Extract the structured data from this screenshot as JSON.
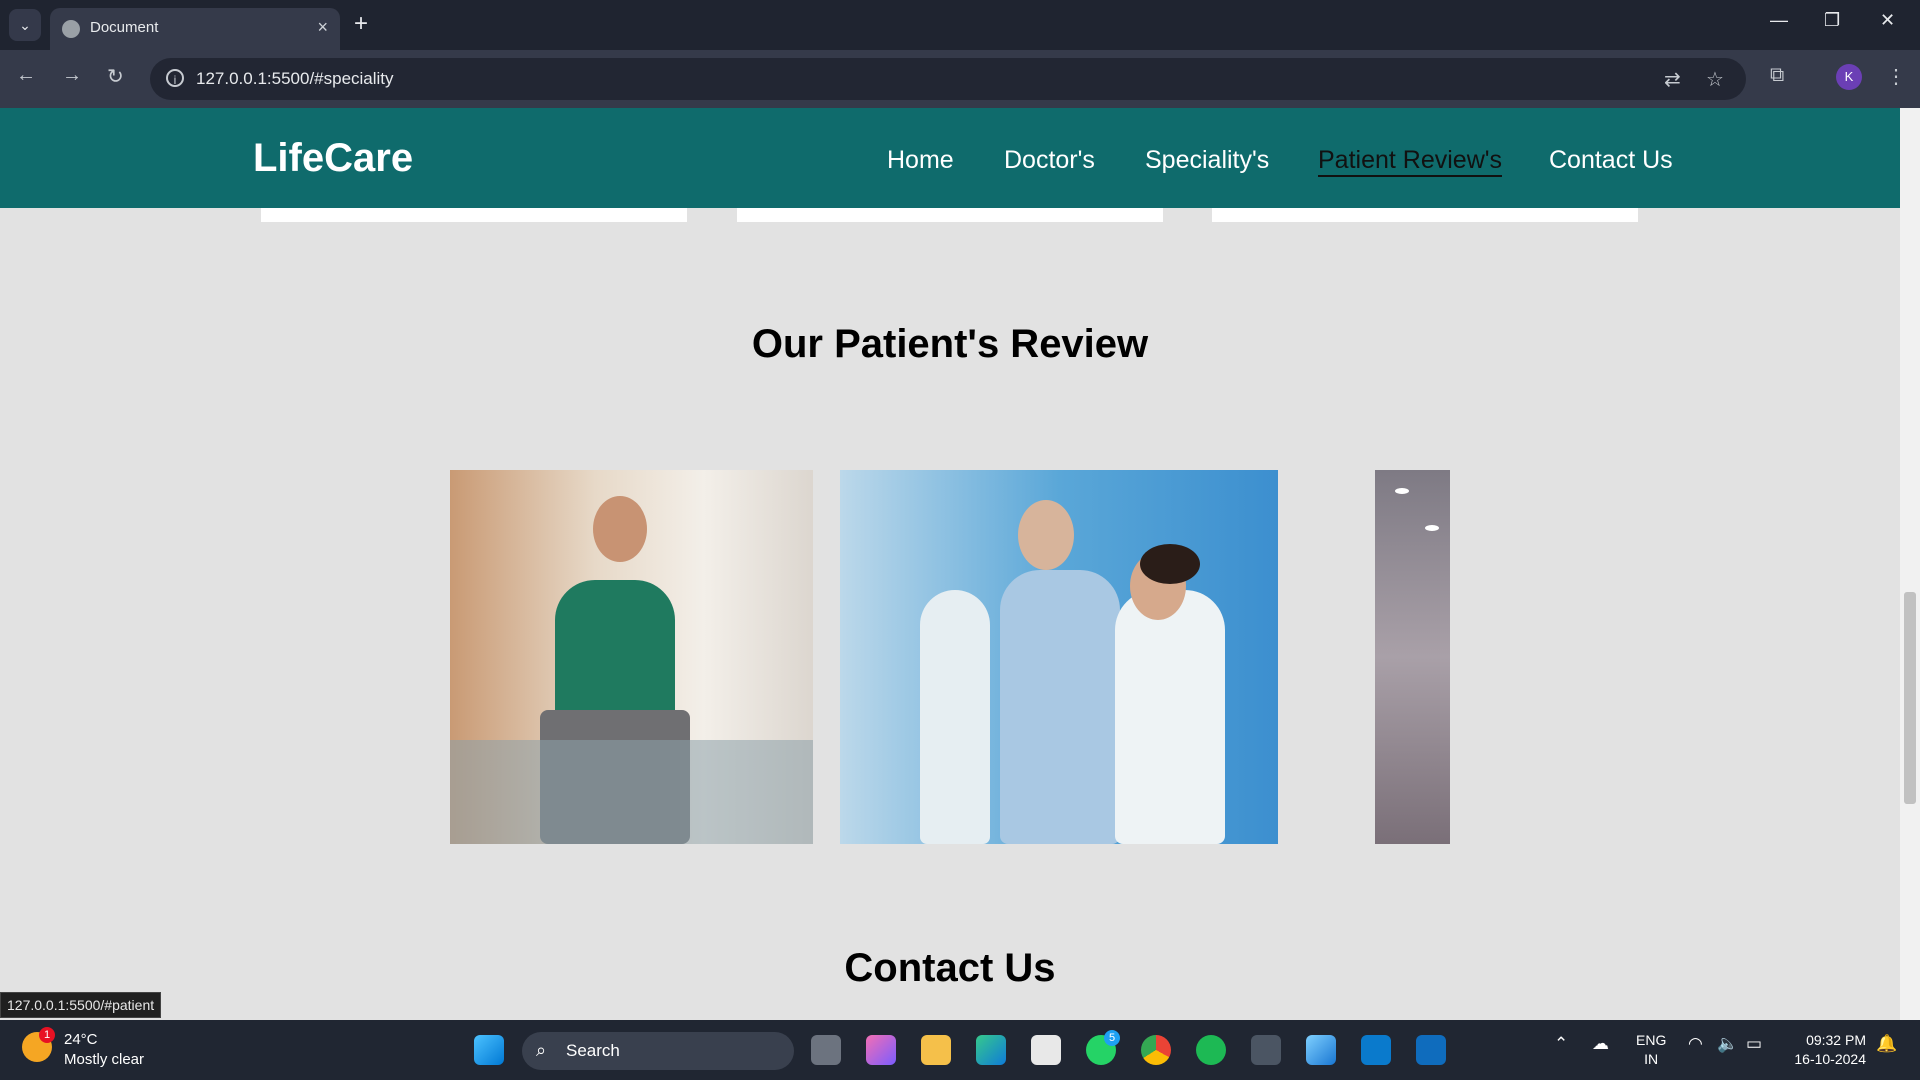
{
  "browser": {
    "tab_title": "Document",
    "url": "127.0.0.1:5500/#speciality",
    "profile_initial": "K",
    "status_url": "127.0.0.1:5500/#patient"
  },
  "site": {
    "logo": "LifeCare",
    "nav": [
      "Home",
      "Doctor's",
      "Speciality's",
      "Patient Review's",
      "Contact Us"
    ],
    "active_nav": "Patient Review's",
    "reviews_title": "Our Patient's Review",
    "contact_title": "Contact Us"
  },
  "taskbar": {
    "weather_badge": "1",
    "temperature": "24°C",
    "condition": "Mostly clear",
    "search_placeholder": "Search",
    "whatsapp_badge": "5",
    "lang_line1": "ENG",
    "lang_line2": "IN",
    "time": "09:32 PM",
    "date": "16-10-2024"
  }
}
